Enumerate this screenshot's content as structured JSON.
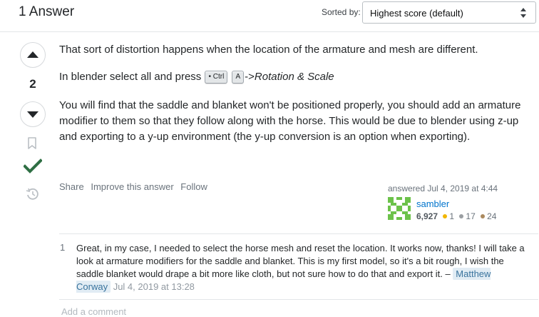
{
  "header": {
    "answers_count": "1 Answer",
    "sorted_by_label": "Sorted by:",
    "sort_value": "Highest score (default)"
  },
  "vote": {
    "score": "2"
  },
  "answer": {
    "p1": "That sort of distortion happens when the location of the armature and mesh are different.",
    "p2_prefix": "In blender select all and press",
    "kbd_ctrl": "• Ctrl",
    "kbd_a": "A",
    "p2_arrow": "->",
    "p2_italic": "Rotation & Scale",
    "p3": "You will find that the saddle and blanket won't be positioned properly, you should add an armature modifier to them so that they follow along with the horse. This would be due to blender using z-up and exporting to a y-up environment (the y-up conversion is an option when exporting)."
  },
  "post_menu": {
    "share": "Share",
    "improve": "Improve this answer",
    "follow": "Follow"
  },
  "user_card": {
    "answered_time": "answered Jul 4, 2019 at 4:44",
    "name": "sambler",
    "reputation": "6,927",
    "gold": "1",
    "silver": "17",
    "bronze": "24",
    "colors": {
      "gold": "#f1b600",
      "silver": "#9a9ea2",
      "bronze": "#ab8a5f"
    }
  },
  "comment": {
    "score": "1",
    "text": "Great, in my case, I needed to select the horse mesh and reset the location. It works now, thanks! I will take a look at armature modifiers for the saddle and blanket. This is my first model, so it's a bit rough, I wish the saddle blanket would drape a bit more like cloth, but not sure how to do that and export it.",
    "dash": "–",
    "author": "Matthew Corway",
    "date": "Jul 4, 2019 at 13:28"
  },
  "add_comment": "Add a comment",
  "icons": [
    "upvote-icon",
    "downvote-icon",
    "bookmark-icon",
    "accepted-check-icon",
    "history-icon",
    "sort-arrows-icon"
  ]
}
